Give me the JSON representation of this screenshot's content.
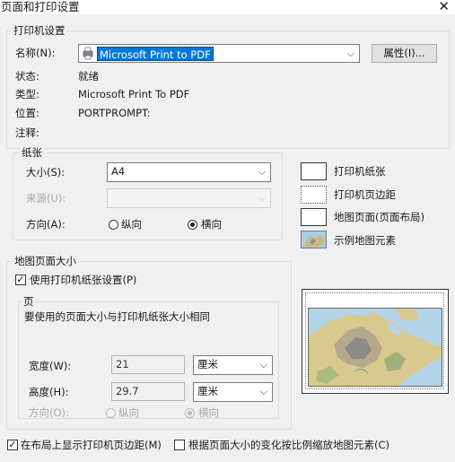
{
  "window": {
    "title": "页面和打印设置"
  },
  "printer_group": {
    "title": "打印机设置",
    "name_label": "名称(N):",
    "name_value": "Microsoft Print to PDF",
    "properties_button": "属性(I)...",
    "status_label": "状态:",
    "status_value": "就绪",
    "type_label": "类型:",
    "type_value": "Microsoft Print To PDF",
    "location_label": "位置:",
    "location_value": "PORTPROMPT:",
    "comment_label": "注释:",
    "comment_value": ""
  },
  "paper_group": {
    "title": "纸张",
    "size_label": "大小(S):",
    "size_value": "A4",
    "source_label": "来源(U):",
    "source_value": "",
    "orientation_label": "方向(A):",
    "portrait": "纵向",
    "landscape": "横向",
    "selected_orientation": "landscape"
  },
  "legend": {
    "printer_paper": "打印机纸张",
    "printer_margins": "打印机页边距",
    "map_page": "地图页面(页面布局)",
    "sample_map": "示例地图元素"
  },
  "map_page_group": {
    "title": "地图页面大小",
    "use_printer_paper": "使用打印机纸张设置(P)",
    "use_printer_paper_checked": true,
    "page_title": "页",
    "page_note": "要使用的页面大小与打印机纸张大小相同",
    "width_label": "宽度(W):",
    "width_value": "21",
    "width_unit": "厘米",
    "height_label": "高度(H):",
    "height_value": "29.7",
    "height_unit": "厘米",
    "orientation_label": "方向(O):",
    "portrait": "纵向",
    "landscape": "横向",
    "selected_orientation": "landscape"
  },
  "bottom": {
    "show_margins": "在布局上显示打印机页边距(M)",
    "show_margins_checked": true,
    "scale_elements": "根据页面大小的变化按比例缩放地图元素(C)",
    "scale_elements_checked": false
  },
  "colors": {
    "selection": "#0078d7",
    "window_bg": "#f0f0f0"
  }
}
